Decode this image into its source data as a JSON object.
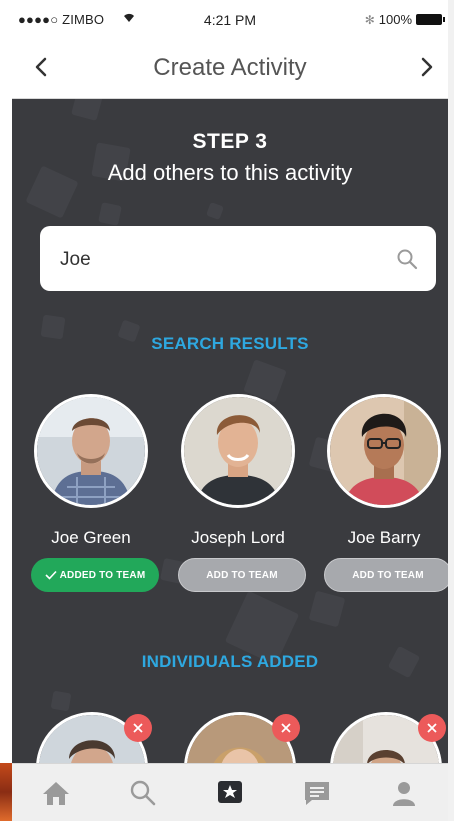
{
  "status_bar": {
    "carrier": "●●●●○ ZIMBO",
    "time": "4:21 PM",
    "battery": "100%"
  },
  "nav": {
    "title": "Create Activity",
    "back_icon": "chevron-left-icon",
    "forward_icon": "chevron-right-icon"
  },
  "step": {
    "label": "STEP 3",
    "subtitle": "Add others to this activity"
  },
  "search": {
    "value": "Joe",
    "icon": "search-icon"
  },
  "search_results": {
    "heading": "SEARCH RESULTS",
    "people": [
      {
        "name": "Joe Green",
        "action": "ADDED TO TEAM",
        "added": true
      },
      {
        "name": "Joseph Lord",
        "action": "ADD TO TEAM",
        "added": false
      },
      {
        "name": "Joe Barry",
        "action": "ADD TO TEAM",
        "added": false
      }
    ]
  },
  "individuals_added": {
    "heading": "INDIVIDUALS ADDED"
  },
  "tab_bar": {
    "items": [
      "home-icon",
      "search-icon",
      "activity-icon",
      "messages-icon",
      "profile-icon"
    ],
    "active": "activity-icon"
  },
  "colors": {
    "accent_blue": "#2ea8e0",
    "added_green": "#22a85a",
    "remove_red": "#ec5a5a",
    "background": "#3a3b3f"
  }
}
